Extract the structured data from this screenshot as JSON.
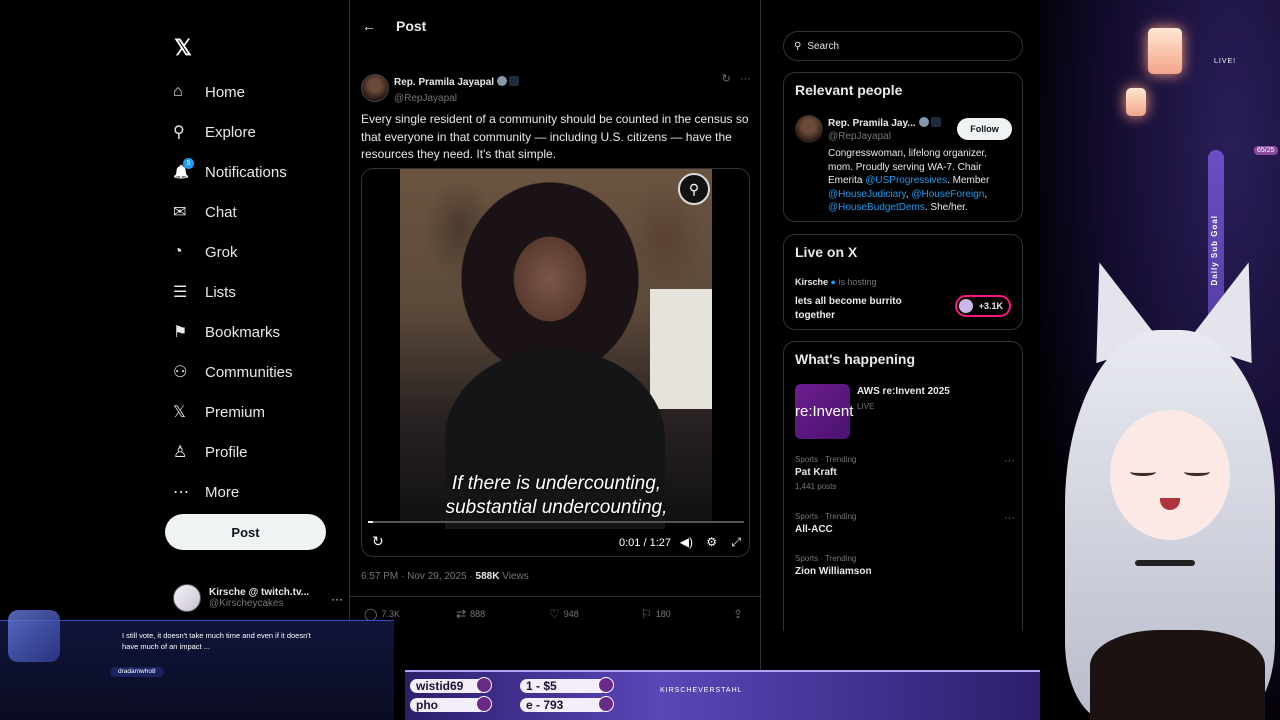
{
  "nav": {
    "logo": "𝕏",
    "items": [
      {
        "label": "Home",
        "icon": "⌂"
      },
      {
        "label": "Explore",
        "icon": "⚲"
      },
      {
        "label": "Notifications",
        "icon": "🔔",
        "badge": "5"
      },
      {
        "label": "Chat",
        "icon": "✉"
      },
      {
        "label": "Grok",
        "icon": "◔"
      },
      {
        "label": "Lists",
        "icon": "☰"
      },
      {
        "label": "Bookmarks",
        "icon": "⚑"
      },
      {
        "label": "Communities",
        "icon": "⚇"
      },
      {
        "label": "Premium",
        "icon": "𝕏"
      },
      {
        "label": "Profile",
        "icon": "♙"
      },
      {
        "label": "More",
        "icon": "⋯"
      }
    ],
    "post_button": "Post",
    "account": {
      "name": "Kirsche @ twitch.tv...",
      "handle": "@Kirscheycakes",
      "more": "···"
    }
  },
  "main": {
    "header": {
      "back": "←",
      "title": "Post"
    },
    "author": {
      "name": "Rep. Pramila Jayapal",
      "handle": "@RepJayapal"
    },
    "text": "Every single resident of a community should be counted in the census so that everyone in that community — including U.S. citizens — have the resources they need. It's that simple.",
    "video": {
      "caption_line1": "If there is undercounting,",
      "caption_line2": "substantial undercounting,",
      "time": "0:01 / 1:27",
      "progress": 0.012
    },
    "meta": {
      "time": "6:57 PM · Nov 29, 2025 · ",
      "views_count": "588K",
      "views_label": " Views"
    },
    "actions": {
      "replies": "7.3K",
      "reposts": "888",
      "likes": "948",
      "bookmarks": "180"
    }
  },
  "right": {
    "search_placeholder": "Search",
    "relevant": {
      "title": "Relevant people",
      "name": "Rep. Pramila Jay...",
      "handle": "@RepJayapal",
      "follow": "Follow",
      "bio_1": "Congresswoman, lifelong organizer, mom. Proudly serving WA-7. Chair Emerita ",
      "bio_link1": "@USProgressives",
      "bio_2": ". Member ",
      "bio_link2": "@HouseJudiciary",
      "bio_3": ", ",
      "bio_link3": "@HouseForeign",
      "bio_4": ", ",
      "bio_link4": "@HouseBudgetDems",
      "bio_5": ". She/her."
    },
    "live": {
      "title": "Live on X",
      "host": "Kirsche",
      "hosting": "is hosting",
      "stream_title": "lets all become burrito together",
      "viewers": "+3.1K"
    },
    "happening": {
      "title": "What's happening",
      "event_thumb": "re:Invent",
      "event": "AWS re:Invent 2025",
      "event_status": "LIVE",
      "trends": [
        {
          "category": "Sports · Trending",
          "name": "Pat Kraft",
          "count": "1,441 posts"
        },
        {
          "category": "Sports · Trending",
          "name": "All-ACC",
          "count": ""
        },
        {
          "category": "Sports · Trending",
          "name": "Zion Williamson",
          "count": ""
        }
      ]
    }
  },
  "overlay": {
    "live_badge": "LIVE!",
    "goal_label": "Daily Sub Goal",
    "goal_count": "65/25",
    "chat_message": "I still vote, it doesn't take much time and even if it doesn't have much of an impact ...",
    "chat_user": "dradamwho8",
    "hud": {
      "user1": "wistid69",
      "user2": "pho",
      "goal1": "1 - $5",
      "goal2": "e - 793",
      "social": "KIRSCHEVERSTAHL"
    }
  }
}
